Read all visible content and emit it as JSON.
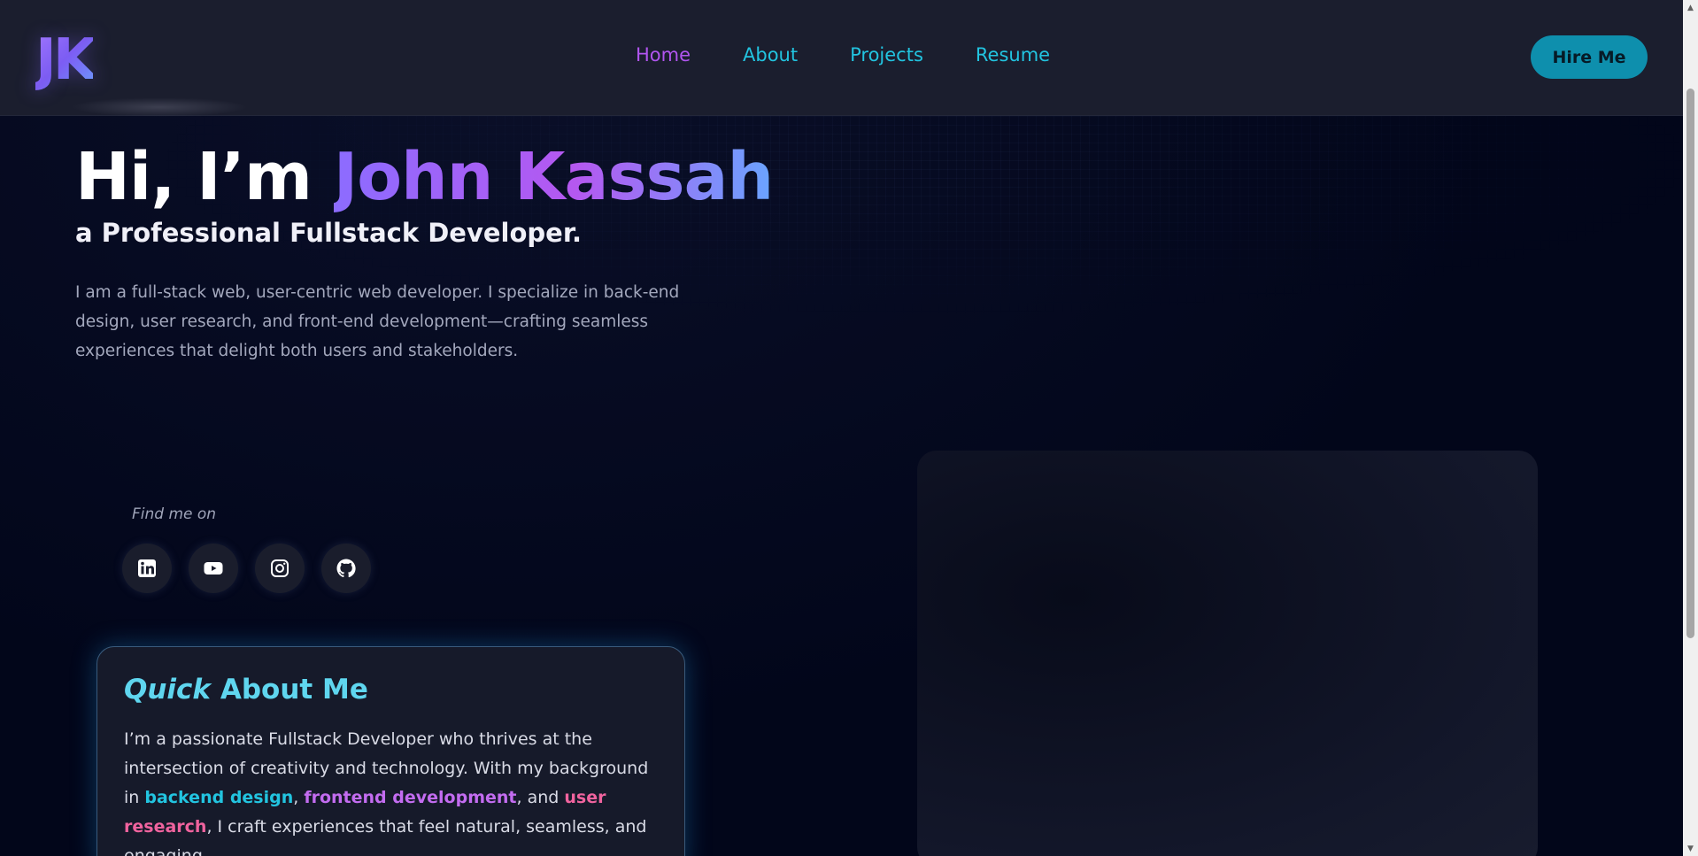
{
  "navbar": {
    "logo": "JK",
    "links": [
      {
        "label": "Home"
      },
      {
        "label": "About"
      },
      {
        "label": "Projects"
      },
      {
        "label": "Resume"
      }
    ],
    "cta": "Hire Me"
  },
  "hero": {
    "greeting": "Hi, I’m ",
    "name": "John Kassah",
    "subtitle": "a Professional Fullstack Developer.",
    "description": "I am a full-stack web, user-centric web developer. I specialize in back-end design, user research, and front-end development—crafting seamless experiences that delight both users and stakeholders."
  },
  "social": {
    "label": "Find me on",
    "icons": [
      "linkedin-icon",
      "youtube-icon",
      "instagram-icon",
      "github-icon"
    ]
  },
  "about_card": {
    "title_italic": "Quick",
    "title_rest": " About Me",
    "text_1": "I’m a passionate Fullstack Developer who thrives at the intersection of creativity and technology. With my background in ",
    "hl_1": "backend design",
    "text_2": ", ",
    "hl_2": "frontend development",
    "text_3": ", and ",
    "hl_3": "user research",
    "text_4": ", I craft experiences that feel natural, seamless, and engaging."
  },
  "colors": {
    "accent_cyan": "#22c4e0",
    "accent_purple": "#b155f0",
    "accent_pink": "#f0639e",
    "background": "#02061a"
  }
}
